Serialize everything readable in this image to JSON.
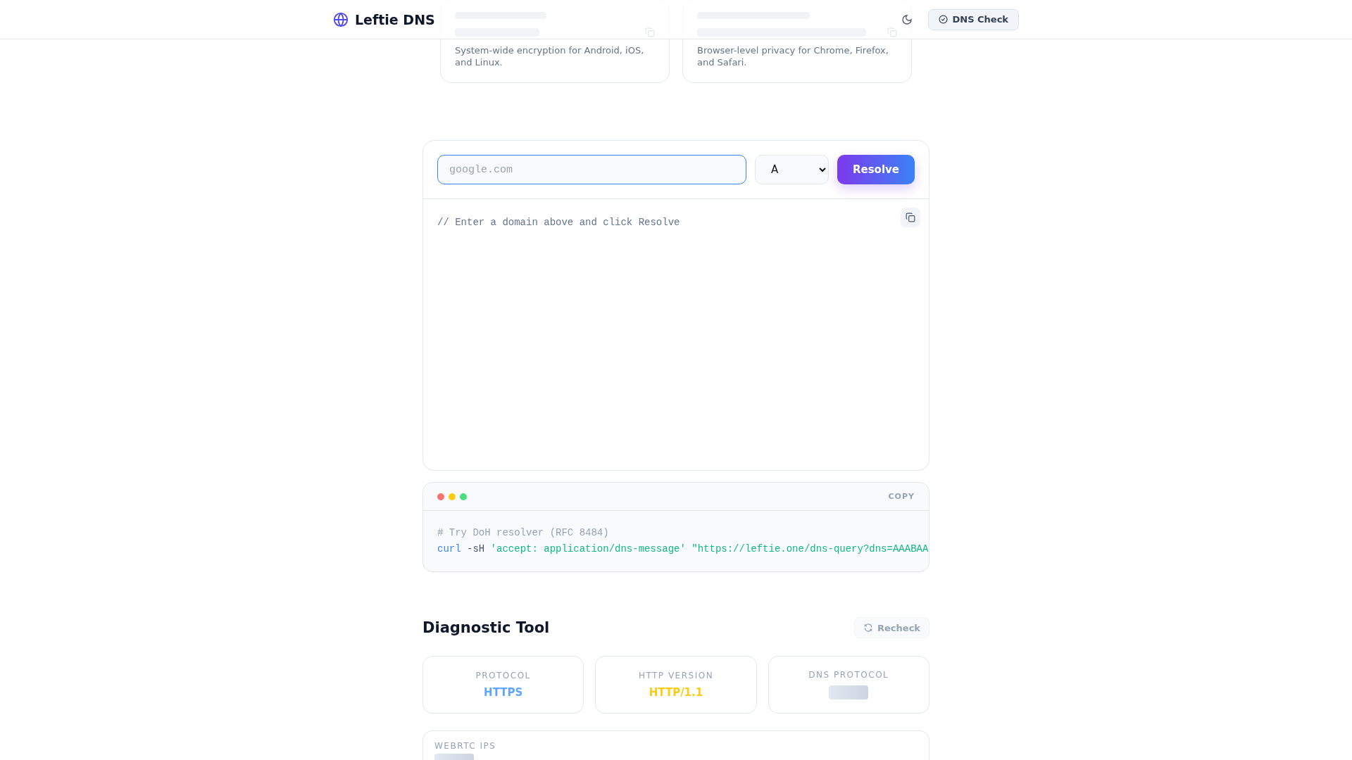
{
  "header": {
    "brand": "Leftie DNS",
    "check_button": "DNS Check"
  },
  "endpoints": [
    {
      "description": "System-wide encryption for Android, iOS, and Linux."
    },
    {
      "description": "Browser-level privacy for Chrome, Firefox, and Safari."
    }
  ],
  "resolver": {
    "domain": {
      "placeholder": "google.com"
    },
    "record_type": "A",
    "button": "Resolve",
    "output": "// Enter a domain above and click Resolve"
  },
  "terminal": {
    "copy": "COPY",
    "lines": [
      {
        "tokens": [
          {
            "kind": "comment",
            "text": "# Try DoH resolver (RFC 8484)"
          }
        ]
      },
      {
        "tokens": [
          {
            "kind": "keyword",
            "text": "curl"
          },
          {
            "kind": "flag",
            "text": "-sH"
          },
          {
            "kind": "string",
            "text": "'accept: application/dns-message'"
          },
          {
            "kind": "string",
            "text": "\"https://leftie.one/dns-query?dns=AAABAA"
          }
        ]
      }
    ]
  },
  "diagnostic": {
    "title": "Diagnostic Tool",
    "recheck": "Recheck",
    "stats": [
      {
        "label": "PROTOCOL",
        "value": "HTTPS",
        "color": "#60a5fa",
        "loading": false
      },
      {
        "label": "HTTP VERSION",
        "value": "HTTP/1.1",
        "color": "#facc15",
        "loading": false
      },
      {
        "label": "DNS PROTOCOL",
        "loading": true
      }
    ],
    "webrtc": {
      "label": "WEBRTC IPS",
      "loading": true
    }
  }
}
